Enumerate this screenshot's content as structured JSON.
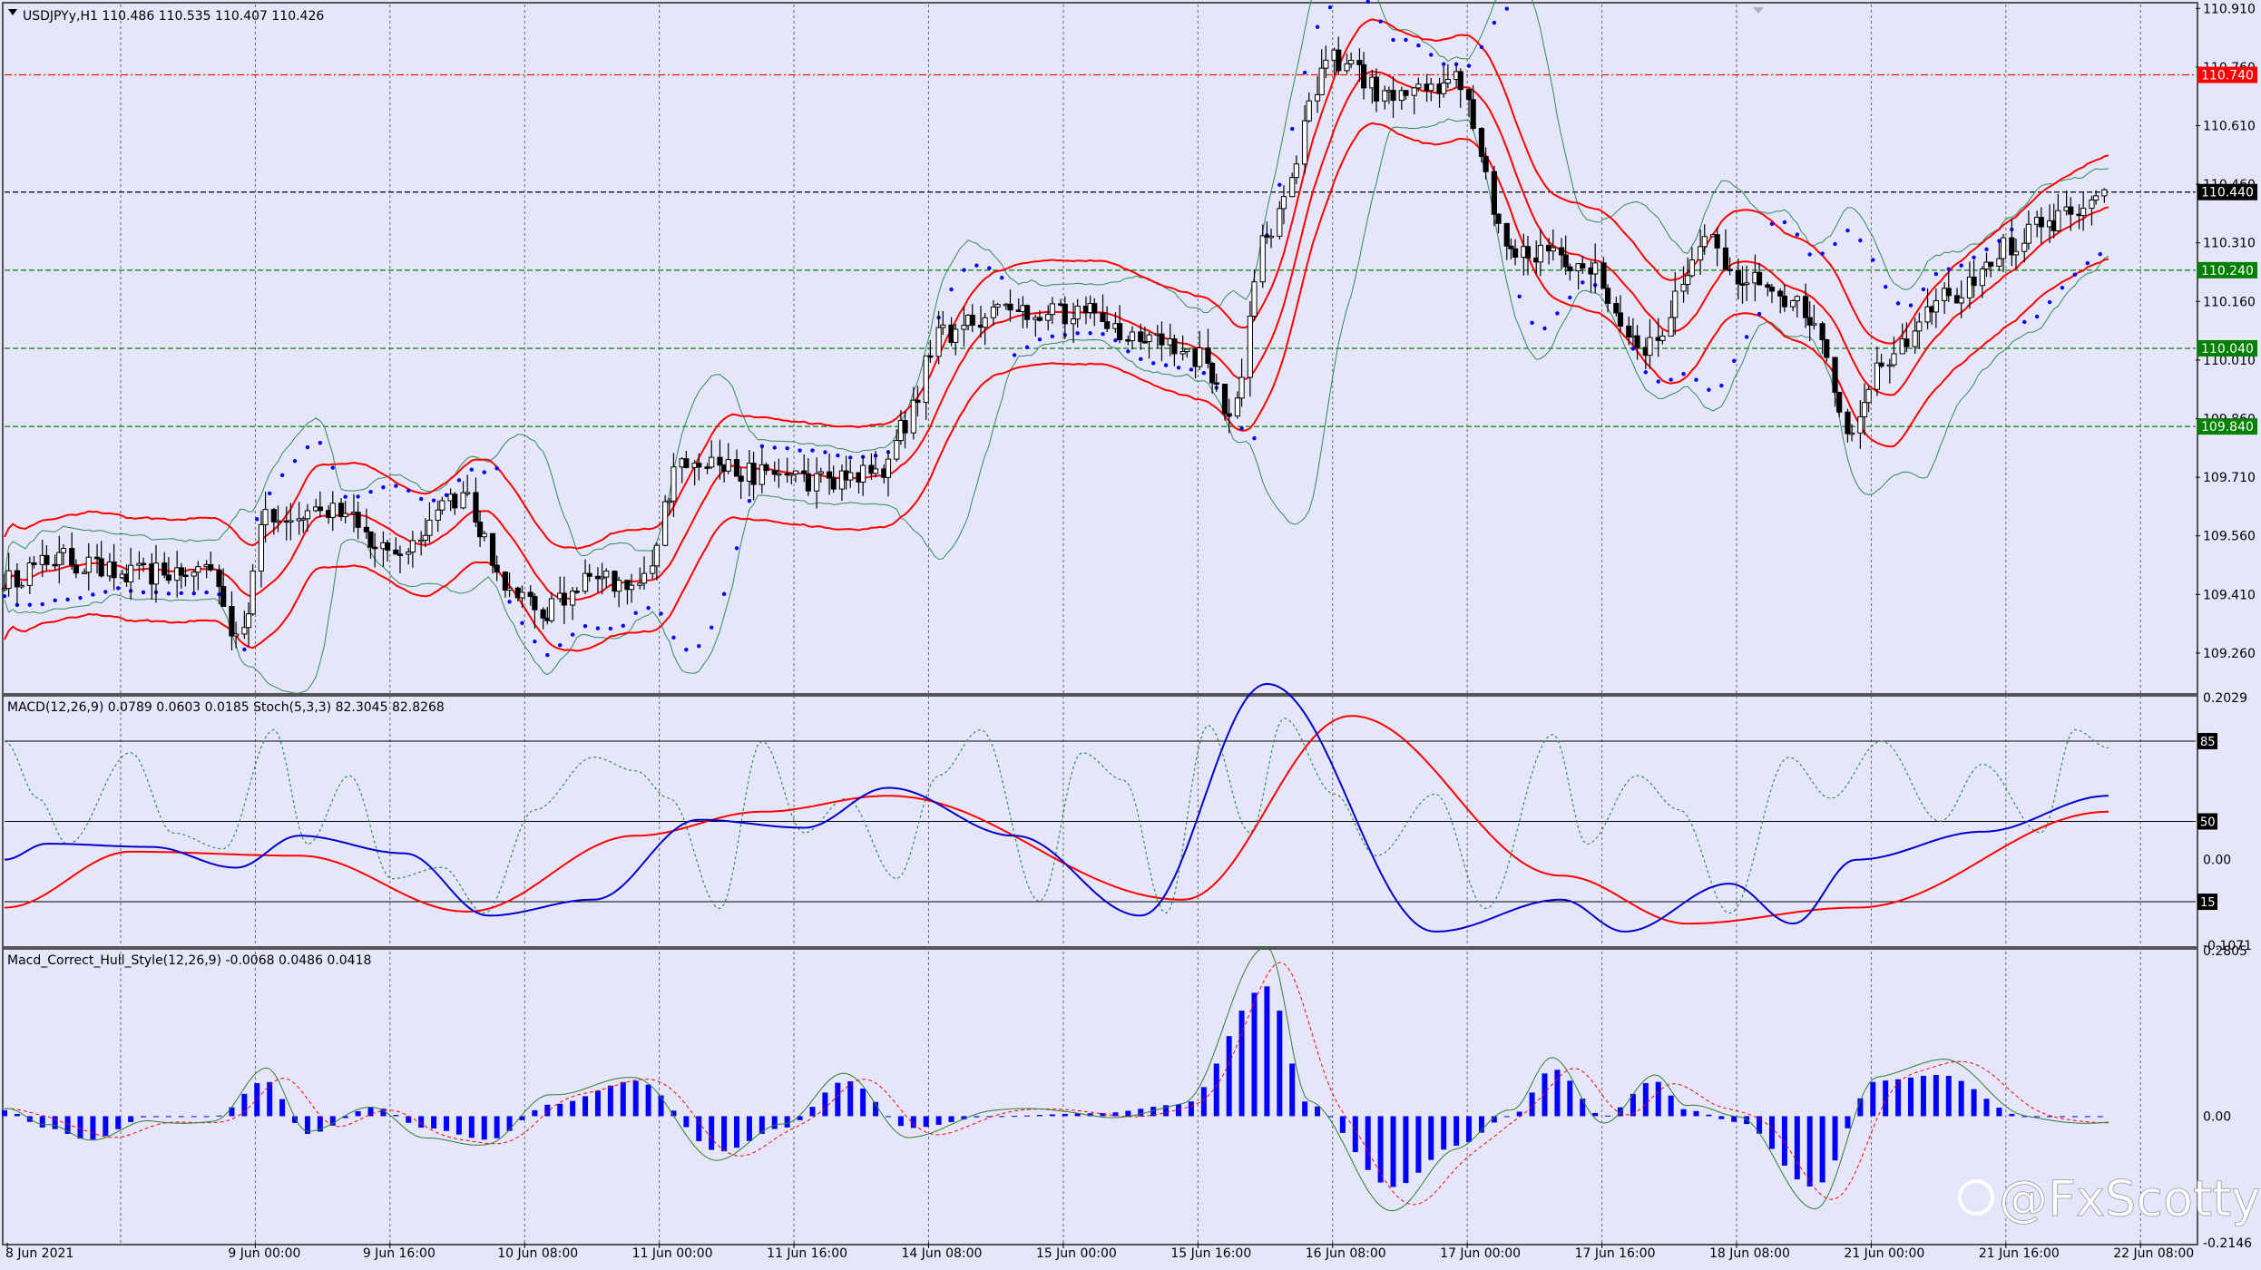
{
  "main": {
    "symbol_line": "USDJPYy,H1  110.486 110.535 110.407 110.426",
    "price_scale": [
      "110.910",
      "110.760",
      "110.610",
      "110.460",
      "110.310",
      "110.160",
      "110.010",
      "109.860",
      "109.710",
      "109.560",
      "109.410",
      "109.260"
    ],
    "levels": [
      {
        "value": 110.74,
        "label": "110.740",
        "color": "#ff0000"
      },
      {
        "value": 110.44,
        "label": "110.440",
        "color": "#000000"
      },
      {
        "value": 110.24,
        "label": "110.240",
        "color": "#008000"
      },
      {
        "value": 110.04,
        "label": "110.040",
        "color": "#008000"
      },
      {
        "value": 109.84,
        "label": "109.840",
        "color": "#008000"
      }
    ],
    "ylim": [
      109.16,
      110.92
    ]
  },
  "macd": {
    "title": "MACD(12,26,9) 0.0789 0.0603 0.0185  Stoch(5,3,3) 82.3045 82.8268",
    "scale": [
      "0.2029",
      "0.00",
      "-0.1071"
    ],
    "stoch_levels": [
      "85",
      "50",
      "15"
    ]
  },
  "hull": {
    "title": "Macd_Correct_Hull_Style(12,26,9) -0.0068 0.0486 0.0418",
    "scale": [
      "0.2805",
      "0.00",
      "-0.2146"
    ]
  },
  "time_axis": [
    "8 Jun 2021",
    "9 Jun 00:00",
    "9 Jun 16:00",
    "10 Jun 08:00",
    "11 Jun 00:00",
    "11 Jun 16:00",
    "14 Jun 08:00",
    "15 Jun 00:00",
    "15 Jun 16:00",
    "16 Jun 08:00",
    "17 Jun 00:00",
    "17 Jun 16:00",
    "18 Jun 08:00",
    "21 Jun 00:00",
    "21 Jun 16:00",
    "22 Jun 08:00"
  ],
  "watermark": "@FxScotty",
  "colors": {
    "background": "#e6e6fa",
    "bull_candle": "#ffffff",
    "bear_candle": "#000000",
    "envelope": "#ff0000",
    "bollinger": "#2e8b57",
    "sar": "#0000ff",
    "macd_main": "#0000cc",
    "macd_signal": "#ff0000",
    "hist": "#0000ff"
  },
  "chart_data": [
    {
      "type": "line",
      "title": "USDJPYy,H1",
      "anchors": [
        [
          0,
          109.45
        ],
        [
          12,
          109.5
        ],
        [
          30,
          109.46
        ],
        [
          48,
          109.48
        ],
        [
          56,
          109.3
        ],
        [
          62,
          109.62
        ],
        [
          78,
          109.62
        ],
        [
          92,
          109.52
        ],
        [
          108,
          109.66
        ],
        [
          120,
          109.44
        ],
        [
          128,
          109.37
        ],
        [
          140,
          109.45
        ],
        [
          150,
          109.42
        ],
        [
          162,
          109.76
        ],
        [
          178,
          109.72
        ],
        [
          196,
          109.7
        ],
        [
          208,
          109.72
        ],
        [
          214,
          109.85
        ],
        [
          222,
          110.08
        ],
        [
          238,
          110.14
        ],
        [
          256,
          110.13
        ],
        [
          272,
          110.06
        ],
        [
          284,
          110.02
        ],
        [
          292,
          109.88
        ],
        [
          300,
          110.35
        ],
        [
          316,
          110.78
        ],
        [
          330,
          110.68
        ],
        [
          345,
          110.72
        ],
        [
          358,
          110.3
        ],
        [
          374,
          110.26
        ],
        [
          390,
          110.05
        ],
        [
          406,
          110.32
        ],
        [
          412,
          110.22
        ],
        [
          424,
          110.16
        ],
        [
          432,
          110.06
        ],
        [
          438,
          109.8
        ],
        [
          446,
          110.02
        ],
        [
          462,
          110.18
        ],
        [
          476,
          110.3
        ],
        [
          486,
          110.36
        ],
        [
          500,
          110.44
        ]
      ]
    },
    {
      "type": "line",
      "title": "MACD(12,26,9) 0.0789 0.0603 0.0185  Stoch(5,3,3) 82.3045 82.8268",
      "ylim": [
        -0.1071,
        0.2029
      ],
      "macd_anchors": [
        [
          0,
          0.0
        ],
        [
          10,
          0.02
        ],
        [
          35,
          0.016
        ],
        [
          55,
          -0.01
        ],
        [
          70,
          0.03
        ],
        [
          95,
          0.008
        ],
        [
          115,
          -0.07
        ],
        [
          140,
          -0.05
        ],
        [
          165,
          0.05
        ],
        [
          190,
          0.04
        ],
        [
          210,
          0.09
        ],
        [
          240,
          0.03
        ],
        [
          270,
          -0.07
        ],
        [
          300,
          0.22
        ],
        [
          340,
          -0.09
        ],
        [
          370,
          -0.05
        ],
        [
          385,
          -0.09
        ],
        [
          410,
          -0.03
        ],
        [
          425,
          -0.08
        ],
        [
          440,
          0.0
        ],
        [
          470,
          0.035
        ],
        [
          500,
          0.08
        ]
      ],
      "signal_anchors": [
        [
          0,
          -0.06
        ],
        [
          30,
          0.01
        ],
        [
          70,
          0.005
        ],
        [
          110,
          -0.065
        ],
        [
          150,
          0.03
        ],
        [
          180,
          0.06
        ],
        [
          210,
          0.08
        ],
        [
          280,
          -0.05
        ],
        [
          320,
          0.18
        ],
        [
          370,
          -0.02
        ],
        [
          400,
          -0.08
        ],
        [
          440,
          -0.06
        ],
        [
          500,
          0.06
        ]
      ],
      "stoch_anchors": [
        [
          0,
          85
        ],
        [
          8,
          60
        ],
        [
          15,
          40
        ],
        [
          30,
          80
        ],
        [
          40,
          45
        ],
        [
          52,
          38
        ],
        [
          64,
          90
        ],
        [
          72,
          40
        ],
        [
          82,
          70
        ],
        [
          92,
          25
        ],
        [
          104,
          30
        ],
        [
          114,
          10
        ],
        [
          126,
          55
        ],
        [
          140,
          78
        ],
        [
          150,
          72
        ],
        [
          158,
          60
        ],
        [
          170,
          12
        ],
        [
          180,
          85
        ],
        [
          190,
          45
        ],
        [
          200,
          60
        ],
        [
          212,
          25
        ],
        [
          222,
          70
        ],
        [
          232,
          90
        ],
        [
          246,
          15
        ],
        [
          256,
          80
        ],
        [
          266,
          68
        ],
        [
          276,
          10
        ],
        [
          286,
          92
        ],
        [
          296,
          45
        ],
        [
          304,
          95
        ],
        [
          316,
          62
        ],
        [
          326,
          35
        ],
        [
          340,
          62
        ],
        [
          352,
          12
        ],
        [
          368,
          88
        ],
        [
          376,
          40
        ],
        [
          388,
          70
        ],
        [
          398,
          55
        ],
        [
          410,
          10
        ],
        [
          424,
          78
        ],
        [
          434,
          60
        ],
        [
          446,
          85
        ],
        [
          460,
          50
        ],
        [
          470,
          75
        ],
        [
          484,
          45
        ],
        [
          492,
          90
        ],
        [
          500,
          82
        ]
      ]
    },
    {
      "type": "bar",
      "title": "Macd_Correct_Hull_Style(12,26,9) -0.0068 0.0486 0.0418",
      "ylim": [
        -0.2146,
        0.2805
      ],
      "hist_anchors": [
        [
          0,
          0.01
        ],
        [
          10,
          -0.02
        ],
        [
          20,
          -0.04
        ],
        [
          35,
          0.0
        ],
        [
          50,
          0.0
        ],
        [
          62,
          0.06
        ],
        [
          72,
          -0.03
        ],
        [
          88,
          0.015
        ],
        [
          100,
          -0.02
        ],
        [
          115,
          -0.04
        ],
        [
          130,
          0.02
        ],
        [
          150,
          0.06
        ],
        [
          170,
          -0.06
        ],
        [
          185,
          -0.02
        ],
        [
          200,
          0.06
        ],
        [
          215,
          -0.02
        ],
        [
          235,
          0.0
        ],
        [
          260,
          0.005
        ],
        [
          280,
          0.02
        ],
        [
          300,
          0.22
        ],
        [
          310,
          0.02
        ],
        [
          330,
          -0.12
        ],
        [
          345,
          -0.05
        ],
        [
          358,
          0.0
        ],
        [
          368,
          0.08
        ],
        [
          380,
          0.0
        ],
        [
          392,
          0.06
        ],
        [
          400,
          0.01
        ],
        [
          412,
          -0.01
        ],
        [
          430,
          -0.12
        ],
        [
          445,
          0.06
        ],
        [
          460,
          0.07
        ],
        [
          480,
          0.0
        ],
        [
          500,
          0.0
        ]
      ]
    }
  ]
}
